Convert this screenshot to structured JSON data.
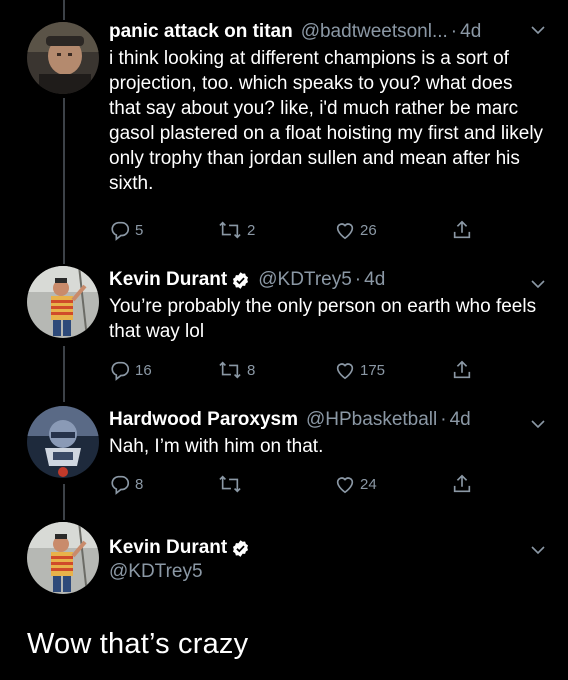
{
  "tweets": [
    {
      "name": "panic attack on titan",
      "handle": "@badtweetsonl...",
      "time": "4d",
      "verified": false,
      "text": "i think looking at different champions is a sort of projection, too.  which speaks to you? what does that say about you? like, i'd much rather be marc gasol plastered on a float hoisting my first and likely only trophy than jordan sullen and mean after his sixth.",
      "replies": "5",
      "retweets": "2",
      "likes": "26"
    },
    {
      "name": "Kevin Durant",
      "handle": "@KDTrey5",
      "time": "4d",
      "verified": true,
      "text": "You’re probably the only person on earth who feels that way lol",
      "replies": "16",
      "retweets": "8",
      "likes": "175"
    },
    {
      "name": "Hardwood Paroxysm",
      "handle": "@HPbasketball",
      "time": "4d",
      "verified": false,
      "text": "Nah, I’m with him on that.",
      "replies": "8",
      "retweets": "",
      "likes": "24"
    }
  ],
  "main_tweet": {
    "name": "Kevin Durant",
    "handle": "@KDTrey5",
    "verified": true,
    "text": "Wow that’s crazy"
  },
  "separator": "·",
  "colors": {
    "background": "#000000",
    "text": "#ffffff",
    "secondary": "#8b98a5",
    "verified": "#ffffff",
    "thread_line": "#3d4248"
  },
  "icons": [
    "reply-icon",
    "retweet-icon",
    "like-icon",
    "share-icon",
    "chevron-down-icon",
    "verified-badge-icon"
  ]
}
